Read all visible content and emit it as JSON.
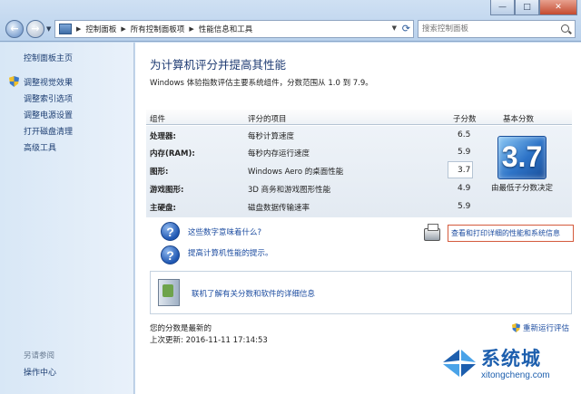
{
  "addressbar": {
    "breadcrumbs": [
      "控制面板",
      "所有控制面板项",
      "性能信息和工具"
    ]
  },
  "search": {
    "placeholder": "搜索控制面板"
  },
  "window_controls": {
    "minimize": "—",
    "maximize": "□",
    "close": "✕"
  },
  "sidebar": {
    "home": "控制面板主页",
    "items": [
      {
        "label": "调整视觉效果",
        "icon": "shield-icon"
      },
      {
        "label": "调整索引选项"
      },
      {
        "label": "调整电源设置"
      },
      {
        "label": "打开磁盘清理"
      },
      {
        "label": "高级工具"
      }
    ],
    "see_also": "另请参阅",
    "action_center": "操作中心"
  },
  "main": {
    "title": "为计算机评分并提高其性能",
    "subtitle": "Windows 体验指数评估主要系统组件，分数范围从 1.0 到 7.9。",
    "table": {
      "headers": {
        "component": "组件",
        "rated": "评分的项目",
        "subscore": "子分数",
        "base": "基本分数"
      },
      "rows": [
        {
          "component": "处理器:",
          "description": "每秒计算速度",
          "subscore": "6.5"
        },
        {
          "component": "内存(RAM):",
          "description": "每秒内存运行速度",
          "subscore": "5.9"
        },
        {
          "component": "图形:",
          "description": "Windows Aero 的桌面性能",
          "subscore": "3.7"
        },
        {
          "component": "游戏图形:",
          "description": "3D 商务和游戏图形性能",
          "subscore": "4.9"
        },
        {
          "component": "主硬盘:",
          "description": "磁盘数据传输速率",
          "subscore": "5.9"
        }
      ],
      "base_score": "3.7",
      "base_caption": "由最低子分数决定"
    },
    "links": {
      "what_mean": "这些数字意味着什么?",
      "tips": "提高计算机性能的提示。",
      "print": "查看和打印详细的性能和系统信息",
      "learn_more": "联机了解有关分数和软件的详细信息"
    },
    "status": {
      "current": "您的分数是最新的",
      "last_update": "上次更新: 2016-11-11 17:14:53",
      "rerun": "重新运行评估"
    }
  },
  "watermark": {
    "brand": "系统城",
    "url": "xitongcheng.com"
  },
  "colors": {
    "link": "#1c4ca0",
    "title": "#1e3b73",
    "score_tile": "#2d73c7",
    "highlight_border": "#d45a3c"
  }
}
